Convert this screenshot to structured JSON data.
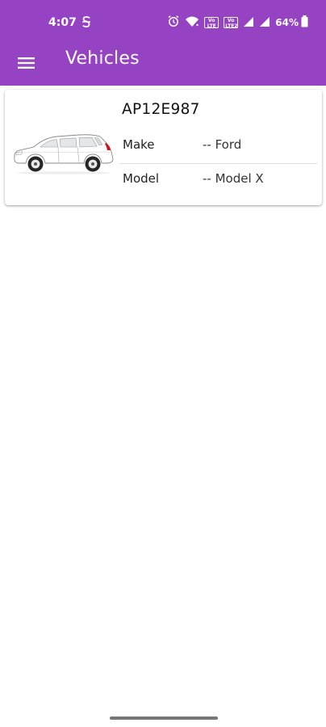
{
  "status_bar": {
    "time": "4:07",
    "battery_percent": "64%",
    "volte1": "Vo LTE",
    "volte2": "Vo LTE2"
  },
  "app_bar": {
    "title": "Vehicles",
    "menu_icon": "hamburger-menu-icon"
  },
  "vehicles": [
    {
      "registration": "AP12E987",
      "make_label": "Make",
      "make_value": "-- Ford",
      "model_label": "Model",
      "model_value": "-- Model X",
      "image": "white-hatchback-car"
    }
  ],
  "colors": {
    "primary": "#9543c2",
    "background": "#ffffff",
    "text": "#111111"
  }
}
